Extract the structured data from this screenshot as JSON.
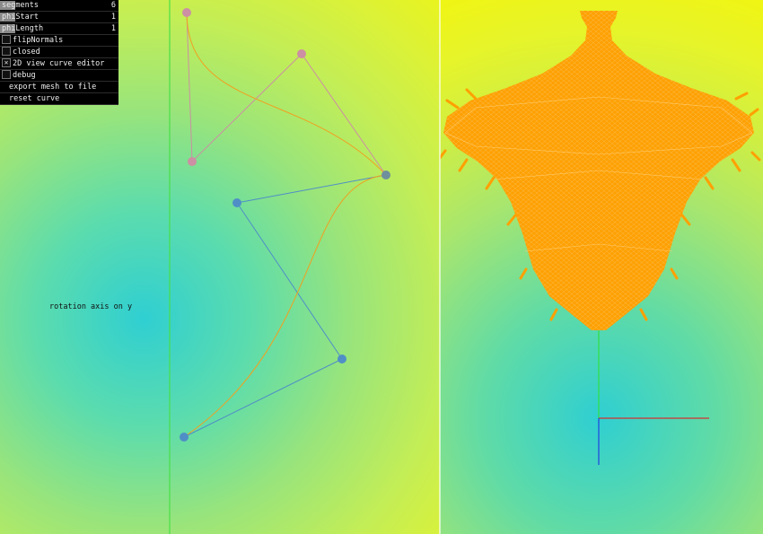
{
  "gui": {
    "sliders": [
      {
        "label": "segments",
        "value": "6"
      },
      {
        "label": "phiStart",
        "value": "1"
      },
      {
        "label": "phiLength",
        "value": "1"
      }
    ],
    "toggles": [
      {
        "label": "flipNormals",
        "checked": false,
        "mark": ""
      },
      {
        "label": "closed",
        "checked": false,
        "mark": ""
      },
      {
        "label": "2D view curve editor",
        "checked": true,
        "mark": "✕"
      },
      {
        "label": "debug",
        "checked": false,
        "mark": ""
      }
    ],
    "buttons": [
      {
        "label": "export mesh to file"
      },
      {
        "label": "reset curve"
      }
    ]
  },
  "editor": {
    "axis_label": "rotation axis on y",
    "axis_color": "#48e046",
    "control_colors": {
      "upper": "#cc8fa3",
      "lower": "#4f8fc6"
    },
    "curve_color": "#f0a020"
  },
  "viewport": {
    "mesh_color": "#ffa000",
    "axis_colors": {
      "x": "#d33030",
      "y": "#30e040",
      "z": "#2040e0"
    }
  }
}
